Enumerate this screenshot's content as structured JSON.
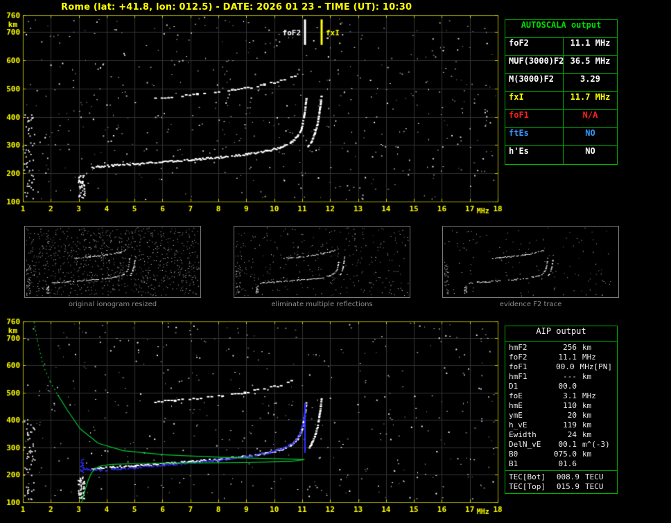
{
  "title": "Rome (lat: +41.8, lon: 012.5) - DATE: 2026 01 23 - TIME (UT): 10:30",
  "colors": {
    "axis": "#a8a800",
    "tick_label": "#ffff00",
    "grid": "#333333",
    "table_border": "#00b400",
    "profile_green": "#00cc33",
    "restored_blue": "#2e2eff",
    "trace_white": "#ffffff",
    "na_red": "#ff2020",
    "ftes_blue": "#3399ff"
  },
  "autoscala_table": {
    "header": "AUTOSCALA output",
    "rows": [
      {
        "label": "foF2",
        "value": "11.1 MHz",
        "color": "#ffffff"
      },
      {
        "label": "MUF(3000)F2",
        "value": "36.5 MHz",
        "color": "#ffffff"
      },
      {
        "label": "M(3000)F2",
        "value": "3.29",
        "color": "#ffffff"
      },
      {
        "label": "fxI",
        "value": "11.7 MHz",
        "color": "#ffff00"
      },
      {
        "label": "foF1",
        "value": "N/A",
        "color": "#ff2020"
      },
      {
        "label": "ftEs",
        "value": "NO",
        "color": "#3399ff"
      },
      {
        "label": "h'Es",
        "value": "NO",
        "color": "#ffffff"
      }
    ]
  },
  "aip_table": {
    "header": "AIP output",
    "rows": [
      {
        "label": "hmF2",
        "value": "256",
        "unit": "km",
        "extra": ""
      },
      {
        "label": "foF2",
        "value": "11.1",
        "unit": "MHz",
        "extra": ""
      },
      {
        "label": "foF1",
        "value": "00.0",
        "unit": "MHz",
        "extra": "[PN]"
      },
      {
        "label": "hmF1",
        "value": "---",
        "unit": "km",
        "extra": ""
      },
      {
        "label": "D1",
        "value": "00.0",
        "unit": "",
        "extra": ""
      },
      {
        "label": "foE",
        "value": "3.1",
        "unit": "MHz",
        "extra": ""
      },
      {
        "label": "hmE",
        "value": "110",
        "unit": "km",
        "extra": ""
      },
      {
        "label": "ymE",
        "value": "20",
        "unit": "km",
        "extra": ""
      },
      {
        "label": "h_vE",
        "value": "119",
        "unit": "km",
        "extra": ""
      },
      {
        "label": "Ewidth",
        "value": "24",
        "unit": "km",
        "extra": ""
      },
      {
        "label": "DelN_vE",
        "value": "00.1",
        "unit": "m^(-3)",
        "extra": ""
      },
      {
        "label": "B0",
        "value": "075.0",
        "unit": "km",
        "extra": ""
      },
      {
        "label": "B1",
        "value": "01.6",
        "unit": "",
        "extra": ""
      }
    ],
    "tec_rows": [
      {
        "label": "TEC[Bot]",
        "value": "008.9",
        "unit": "TECU"
      },
      {
        "label": "TEC[Top]",
        "value": "015.9",
        "unit": "TECU"
      }
    ]
  },
  "thumbnails": [
    {
      "caption": "original ionogram resized",
      "seed": 101,
      "noise_count": 950
    },
    {
      "caption": "eliminate multiple reflections",
      "seed": 202,
      "noise_count": 330
    },
    {
      "caption": "evidence F2 trace",
      "seed": 303,
      "noise_count": 130
    }
  ],
  "chart_data": [
    {
      "id": "main_ionogram",
      "type": "scatter",
      "title": "",
      "xlabel": "MHz",
      "ylabel": "km",
      "xlim": [
        1,
        18
      ],
      "ylim": [
        100,
        760
      ],
      "x_ticks": [
        1,
        2,
        3,
        4,
        5,
        6,
        7,
        8,
        9,
        10,
        11,
        12,
        13,
        14,
        15,
        16,
        17,
        18
      ],
      "y_ticks": [
        100,
        200,
        300,
        400,
        500,
        600,
        700,
        760
      ],
      "grid": true,
      "noise": {
        "count": 560,
        "seed": 7
      },
      "annotations": [
        {
          "label": "foF2",
          "freq_mhz": 11.1,
          "color": "#ffffff"
        },
        {
          "label": "fxI",
          "freq_mhz": 11.7,
          "color": "#ffff00"
        }
      ],
      "series": [
        {
          "name": "F2-trace-ordinary",
          "color": "#ffffff",
          "style": "trace",
          "points": [
            [
              3.4,
              222
            ],
            [
              3.7,
              226
            ],
            [
              4.2,
              230
            ],
            [
              5.0,
              235
            ],
            [
              6.0,
              242
            ],
            [
              7.0,
              250
            ],
            [
              8.0,
              259
            ],
            [
              9.0,
              270
            ],
            [
              9.7,
              281
            ],
            [
              10.2,
              294
            ],
            [
              10.55,
              310
            ],
            [
              10.8,
              332
            ],
            [
              10.95,
              362
            ],
            [
              11.03,
              400
            ],
            [
              11.08,
              435
            ],
            [
              11.12,
              468
            ]
          ]
        },
        {
          "name": "F2-trace-extraordinary",
          "color": "#ffffff",
          "style": "trace",
          "points": [
            [
              11.18,
              295
            ],
            [
              11.3,
              315
            ],
            [
              11.42,
              342
            ],
            [
              11.52,
              378
            ],
            [
              11.58,
              415
            ],
            [
              11.63,
              450
            ],
            [
              11.66,
              478
            ]
          ]
        },
        {
          "name": "second-reflection-trace",
          "color": "#ffffff",
          "style": "sparse",
          "points": [
            [
              5.7,
              468
            ],
            [
              6.4,
              474
            ],
            [
              7.2,
              482
            ],
            [
              8.1,
              492
            ],
            [
              8.9,
              503
            ],
            [
              9.6,
              516
            ],
            [
              10.2,
              530
            ],
            [
              10.7,
              548
            ]
          ]
        },
        {
          "name": "E-region-scatter",
          "color": "#ffffff",
          "style": "cluster",
          "center": [
            3.08,
            155
          ],
          "spread": [
            0.12,
            40
          ],
          "count": 45
        },
        {
          "name": "left-edge-noise",
          "color": "#dddddd",
          "style": "cluster",
          "center": [
            1.2,
            260
          ],
          "spread": [
            0.22,
            150
          ],
          "count": 55
        }
      ]
    },
    {
      "id": "profile_ionogram",
      "type": "scatter",
      "title": "",
      "xlabel": "MHz",
      "ylabel": "km",
      "xlim": [
        1,
        18
      ],
      "ylim": [
        100,
        760
      ],
      "x_ticks": [
        1,
        2,
        3,
        4,
        5,
        6,
        7,
        8,
        9,
        10,
        11,
        12,
        13,
        14,
        15,
        16,
        17,
        18
      ],
      "y_ticks": [
        100,
        200,
        300,
        400,
        500,
        600,
        700,
        760
      ],
      "grid": true,
      "noise": {
        "count": 460,
        "seed": 13
      },
      "annotations": [],
      "series": [
        {
          "name": "F2-trace-ordinary",
          "color": "#ffffff",
          "style": "trace",
          "points": [
            [
              3.4,
              222
            ],
            [
              3.7,
              226
            ],
            [
              4.2,
              230
            ],
            [
              5.0,
              235
            ],
            [
              6.0,
              242
            ],
            [
              7.0,
              250
            ],
            [
              8.0,
              259
            ],
            [
              9.0,
              270
            ],
            [
              9.7,
              281
            ],
            [
              10.2,
              294
            ],
            [
              10.55,
              310
            ],
            [
              10.8,
              332
            ],
            [
              10.95,
              362
            ],
            [
              11.03,
              400
            ],
            [
              11.08,
              435
            ],
            [
              11.12,
              468
            ]
          ]
        },
        {
          "name": "F2-trace-extraordinary",
          "color": "#ffffff",
          "style": "trace",
          "points": [
            [
              11.18,
              295
            ],
            [
              11.3,
              315
            ],
            [
              11.42,
              342
            ],
            [
              11.52,
              378
            ],
            [
              11.58,
              415
            ],
            [
              11.63,
              450
            ],
            [
              11.66,
              478
            ]
          ]
        },
        {
          "name": "second-reflection-trace",
          "color": "#ffffff",
          "style": "sparse",
          "points": [
            [
              5.7,
              468
            ],
            [
              6.4,
              474
            ],
            [
              7.2,
              482
            ],
            [
              8.1,
              492
            ],
            [
              8.9,
              503
            ],
            [
              9.6,
              516
            ],
            [
              10.2,
              530
            ],
            [
              10.7,
              548
            ]
          ]
        },
        {
          "name": "E-region-scatter",
          "color": "#ffffff",
          "style": "cluster",
          "center": [
            3.08,
            155
          ],
          "spread": [
            0.12,
            40
          ],
          "count": 45
        },
        {
          "name": "left-edge-noise",
          "color": "#dddddd",
          "style": "cluster",
          "center": [
            1.2,
            260
          ],
          "spread": [
            0.22,
            150
          ],
          "count": 55
        },
        {
          "name": "restored-F2-trace",
          "color": "#2e2eff",
          "style": "blue",
          "points": [
            [
              3.05,
              233
            ],
            [
              3.3,
              221
            ],
            [
              3.8,
              219
            ],
            [
              4.5,
              224
            ],
            [
              5.2,
              230
            ],
            [
              6.0,
              237
            ],
            [
              7.0,
              246
            ],
            [
              8.0,
              256
            ],
            [
              9.0,
              269
            ],
            [
              9.8,
              283
            ],
            [
              10.3,
              298
            ],
            [
              10.7,
              320
            ],
            [
              10.9,
              350
            ],
            [
              11.0,
              385
            ],
            [
              11.06,
              425
            ],
            [
              11.1,
              462
            ]
          ]
        },
        {
          "name": "restored-trace-asymptote",
          "color": "#2e2eff",
          "style": "vline",
          "f": 11.1,
          "km_range": [
            285,
            462
          ]
        },
        {
          "name": "restored-trace-start",
          "color": "#2e2eff",
          "style": "cluster",
          "center": [
            3.08,
            235
          ],
          "spread": [
            0.07,
            25
          ],
          "count": 14
        },
        {
          "name": "electron-density-profile",
          "color": "#00cc33",
          "style": "profile",
          "dotted_above_km": 520,
          "points": [
            [
              1.4,
              758
            ],
            [
              1.52,
              690
            ],
            [
              1.72,
              600
            ],
            [
              1.98,
              540
            ],
            [
              2.25,
              492
            ],
            [
              2.6,
              435
            ],
            [
              3.05,
              368
            ],
            [
              3.7,
              315
            ],
            [
              4.6,
              288
            ],
            [
              6.1,
              273
            ],
            [
              8.1,
              264
            ],
            [
              10.0,
              259
            ],
            [
              11.08,
              256
            ],
            [
              10.6,
              249
            ],
            [
              9.4,
              246
            ],
            [
              7.8,
              244
            ],
            [
              6.2,
              243
            ],
            [
              5.0,
              241
            ],
            [
              4.2,
              238
            ],
            [
              3.8,
              233
            ],
            [
              3.6,
              224
            ],
            [
              3.45,
              206
            ],
            [
              3.33,
              178
            ],
            [
              3.22,
              142
            ],
            [
              3.14,
              112
            ],
            [
              3.1,
              100
            ]
          ]
        }
      ]
    }
  ]
}
